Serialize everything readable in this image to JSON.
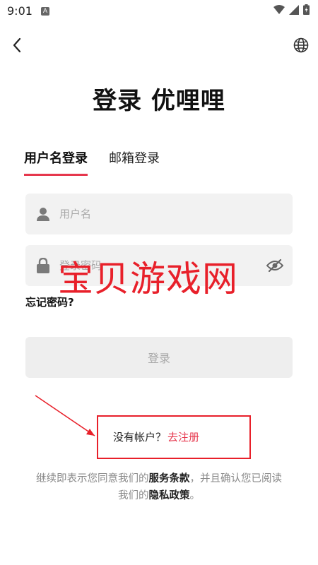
{
  "status_bar": {
    "time": "9:01",
    "a_badge": "A"
  },
  "header": {
    "title": "登录 优哩哩"
  },
  "tabs": [
    {
      "label": "用户名登录",
      "active": true
    },
    {
      "label": "邮箱登录",
      "active": false
    }
  ],
  "form": {
    "username_placeholder": "用户名",
    "password_placeholder": "登录密码",
    "forgot_label": "忘记密码?",
    "login_label": "登录"
  },
  "register": {
    "prompt": "没有帐户？",
    "link": "去注册"
  },
  "terms": {
    "line1_prefix": "继续即表示您同意我们的",
    "terms_link": "服务条款",
    "line1_suffix": "，并且确认您已阅读",
    "line2_prefix": "我们的",
    "privacy_link": "隐私政策",
    "line2_suffix": "。"
  },
  "watermark": "宝贝游戏网",
  "colors": {
    "accent": "#e6374d",
    "watermark": "#e8202a",
    "input_bg": "#f2f2f2",
    "button_disabled_bg": "#eeeeee"
  },
  "icons": {
    "back": "chevron-left-icon",
    "globe": "globe-icon",
    "user": "user-icon",
    "lock": "lock-icon",
    "eye_off": "eye-off-icon"
  }
}
